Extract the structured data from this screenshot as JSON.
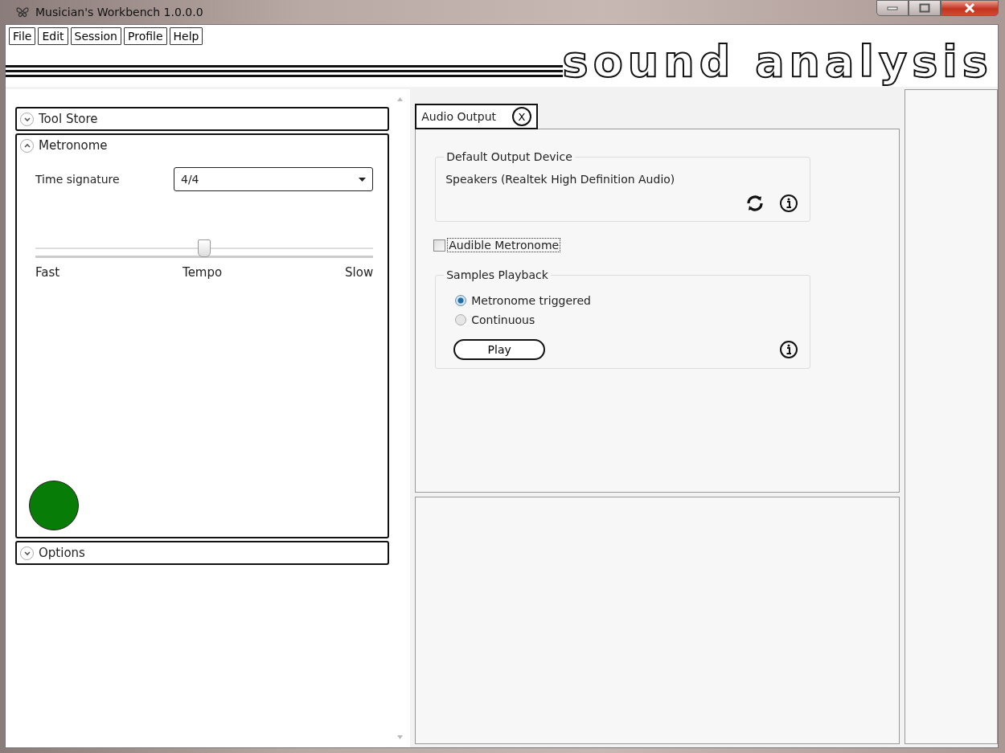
{
  "window": {
    "title": "Musician's Workbench 1.0.0.0"
  },
  "menu": [
    "File",
    "Edit",
    "Session",
    "Profile",
    "Help"
  ],
  "logo": "sound analysis",
  "sidebar": {
    "sections": [
      {
        "kind": "plain",
        "title": "Tool Store",
        "expanded": false
      },
      {
        "kind": "metronome",
        "title": "Metronome",
        "expanded": true,
        "time_signature": {
          "label": "Time signature",
          "value": "4/4"
        },
        "tempo": {
          "level": 0.5,
          "labels": [
            "Fast",
            "Tempo",
            "Slow"
          ]
        }
      },
      {
        "kind": "plain",
        "title": "Options",
        "expanded": false
      }
    ]
  },
  "tabs": [
    {
      "label": "Audio Output",
      "close": "X",
      "selected": true
    }
  ],
  "output_device": {
    "title": "Default Output Device",
    "device": "Speakers (Realtek High Definition Audio)"
  },
  "audible_metronome": {
    "label": "Audible Metronome",
    "checked": false
  },
  "samples_playback": {
    "title": "Samples Playback",
    "options": [
      {
        "label": "Metronome triggered",
        "selected": true
      },
      {
        "label": "Continuous",
        "selected": false
      }
    ],
    "button": "Play"
  }
}
